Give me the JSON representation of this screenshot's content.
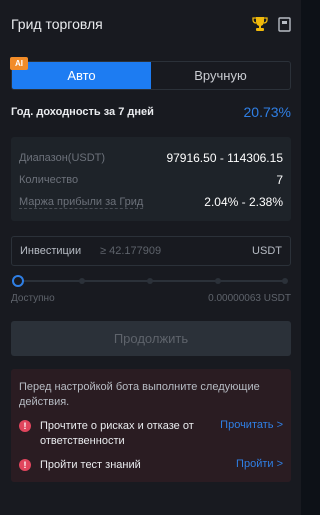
{
  "header": {
    "title": "Грид торговля",
    "icons": [
      "trophy-icon",
      "book-icon"
    ]
  },
  "mode_switch": {
    "ai_badge": "AI",
    "auto_label": "Авто",
    "manual_label": "Вручную",
    "active": "auto"
  },
  "yield": {
    "label": "Год. доходность за 7 дней",
    "value": "20.73%"
  },
  "info": {
    "range_label": "Диапазон(USDT)",
    "range_value": "97916.50 - 114306.15",
    "qty_label": "Количество",
    "qty_value": "7",
    "margin_label": "Маржа прибыли за Грид",
    "margin_value": "2.04% - 2.38%"
  },
  "investment": {
    "label": "Инвестиции",
    "placeholder": "≥ 42.177909",
    "unit": "USDT",
    "slider_level": 0
  },
  "available": {
    "label": "Доступно",
    "value": "0.00000063 USDT"
  },
  "continue_label": "Продолжить",
  "notice": {
    "intro": "Перед настройкой бота выполните следующие действия.",
    "items": [
      {
        "text": "Прочтите о рисках и отказе от ответственности",
        "link": "Прочитать >"
      },
      {
        "text": "Пройти тест знаний",
        "link": "Пройти >"
      }
    ]
  },
  "colors": {
    "accent": "#1d7cf2",
    "yield": "#2f7fe5",
    "warning": "#e0455d",
    "badge": "#f28c28"
  }
}
